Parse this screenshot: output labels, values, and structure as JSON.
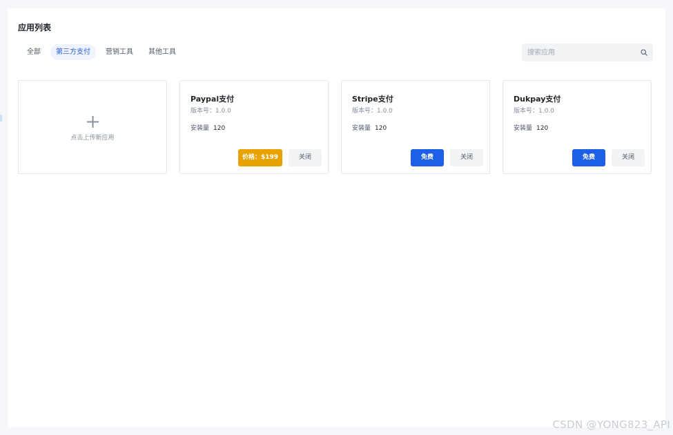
{
  "page": {
    "title": "应用列表"
  },
  "tabs": [
    {
      "label": "全部",
      "active": false
    },
    {
      "label": "第三方支付",
      "active": true
    },
    {
      "label": "营销工具",
      "active": false
    },
    {
      "label": "其他工具",
      "active": false
    }
  ],
  "search": {
    "placeholder": "搜索应用",
    "value": "",
    "icon": "search-icon"
  },
  "upload": {
    "icon": "plus-icon",
    "label": "点击上传新应用"
  },
  "apps": [
    {
      "name": "Paypal支付",
      "version": "版本号：1.0.0",
      "install_label": "安装量",
      "install_count": "120",
      "primary_button": "价格：$199",
      "close_button": "关闭"
    },
    {
      "name": "Stripe支付",
      "version": "版本号：1.0.0",
      "install_label": "安装量",
      "install_count": "120",
      "primary_button": "免费",
      "close_button": "关闭"
    },
    {
      "name": "Dukpay支付",
      "version": "版本号：1.0.0",
      "install_label": "安装量",
      "install_count": "120",
      "primary_button": "免费",
      "close_button": "关闭"
    }
  ],
  "colors": {
    "accent": "#1e5fe8",
    "price": "#e8a302",
    "active_tab_bg": "#eef3fd",
    "active_tab_text": "#2b5fd9"
  },
  "watermark": "CSDN @YONG823_API"
}
